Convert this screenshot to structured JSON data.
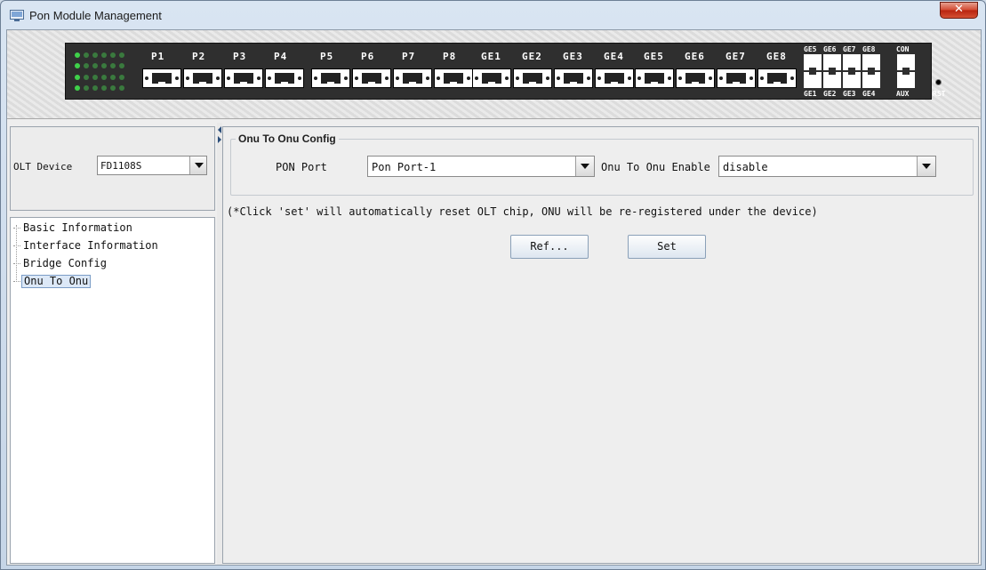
{
  "window": {
    "title": "Pon Module Management",
    "close_glyph": "✕",
    "icon": "app-window-icon"
  },
  "device": {
    "port_labels": [
      "P1",
      "P2",
      "P3",
      "P4",
      "P5",
      "P6",
      "P7",
      "P8",
      "GE1",
      "GE2",
      "GE3",
      "GE4",
      "GE5",
      "GE6",
      "GE7",
      "GE8"
    ],
    "ge_top_labels": [
      "GE5",
      "GE6",
      "GE7",
      "GE8"
    ],
    "ge_bottom_labels": [
      "GE1",
      "GE2",
      "GE3",
      "GE4"
    ],
    "con_label": "CON",
    "aux_label": "AUX",
    "rst_label": "RST",
    "led_color": "#3fd14a",
    "led_off_color": "#3a7a3e"
  },
  "sidebar": {
    "olt_label": "OLT Device",
    "olt_value": "FD1108S",
    "tree": [
      {
        "label": "Basic Information",
        "selected": false
      },
      {
        "label": "Interface Information",
        "selected": false
      },
      {
        "label": "Bridge Config",
        "selected": false
      },
      {
        "label": "Onu To Onu",
        "selected": true
      }
    ]
  },
  "main": {
    "group_title": "Onu To Onu Config",
    "pon_port_label": "PON Port",
    "pon_port_value": "Pon Port-1",
    "enable_label": "Onu To Onu Enable",
    "enable_value": "disable",
    "note": "(*Click 'set' will automatically reset OLT chip, ONU will be re-registered under the device)",
    "refresh_button": "Ref...",
    "set_button": "Set"
  }
}
